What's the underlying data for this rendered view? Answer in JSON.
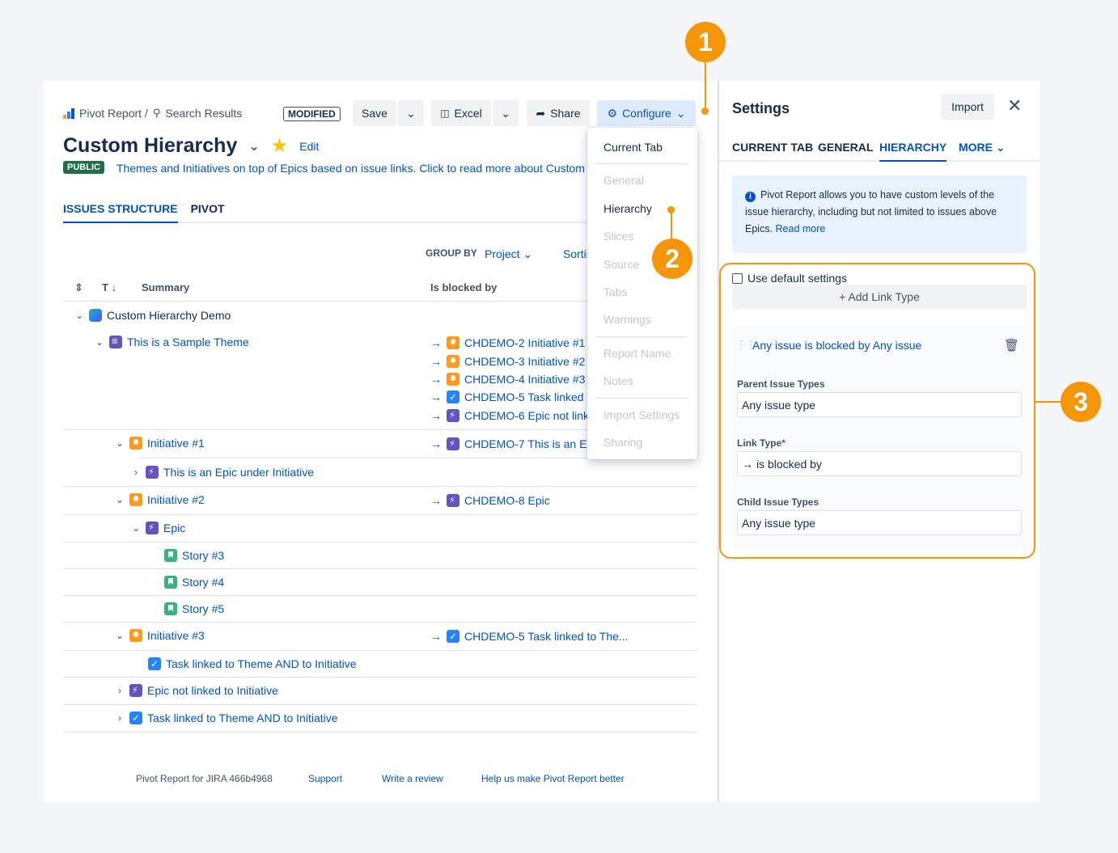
{
  "breadcrumb": {
    "root": "Pivot Report /",
    "current": "Search Results"
  },
  "status_badge": "MODIFIED",
  "toolbar": {
    "save": "Save",
    "excel": "Excel",
    "share": "Share",
    "configure": "Configure"
  },
  "report": {
    "title": "Custom Hierarchy",
    "edit": "Edit",
    "visibility": "PUBLIC",
    "description": "Themes and Initiatives on top of Epics based on issue links. Click to read more about Custom Hierarchy"
  },
  "tabs": [
    "ISSUES STRUCTURE",
    "PIVOT"
  ],
  "group_by": {
    "label": "GROUP BY",
    "value": "Project",
    "sorting": "Sorting"
  },
  "columns": {
    "type": "T",
    "summary": "Summary",
    "blocked_by": "Is blocked by"
  },
  "rows": {
    "project": "Custom Hierarchy Demo",
    "theme": "This is a Sample Theme",
    "theme_links": [
      "CHDEMO-2 Initiative #1",
      "CHDEMO-3 Initiative #2",
      "CHDEMO-4 Initiative #3",
      "CHDEMO-5 Task linked to Theme",
      "CHDEMO-6 Epic not linked"
    ],
    "initiative1": "Initiative #1",
    "initiative1_link": "CHDEMO-7 This is an Epic",
    "epic_under": "This is an Epic under Initiative",
    "initiative2": "Initiative #2",
    "initiative2_link": "CHDEMO-8 Epic",
    "epic": "Epic",
    "story3": "Story #3",
    "story4": "Story #4",
    "story5": "Story #5",
    "initiative3": "Initiative #3",
    "initiative3_link": "CHDEMO-5 Task linked to The...",
    "task_under": "Task linked to Theme AND to Initiative",
    "epic_not_linked": "Epic not linked to Initiative",
    "task_theme": "Task linked to Theme AND to Initiative"
  },
  "configure_menu": {
    "current_tab": "Current Tab",
    "general": "General",
    "hierarchy": "Hierarchy",
    "slices": "Slices",
    "source": "Source",
    "tabs": "Tabs",
    "warnings": "Warnings",
    "report_name": "Report Name",
    "notes": "Notes",
    "import_settings": "Import Settings",
    "sharing": "Sharing"
  },
  "footer": {
    "version": "Pivot Report for JIRA 466b4968",
    "support": "Support",
    "review": "Write a review",
    "feedback": "Help us make Pivot Report better"
  },
  "settings": {
    "title": "Settings",
    "import": "Import",
    "tabs": [
      "CURRENT TAB",
      "GENERAL",
      "HIERARCHY",
      "MORE"
    ],
    "info_text": "Pivot Report allows you to have custom levels of the issue hierarchy, including but not limited to issues above Epics.",
    "read_more": "Read more",
    "use_default": "Use default settings",
    "add_link": "+ Add Link Type",
    "rule_title": "Any issue is blocked by Any issue",
    "parent_label": "Parent Issue Types",
    "parent_value": "Any issue type",
    "link_label": "Link Type",
    "link_value": "is blocked by",
    "child_label": "Child Issue Types",
    "child_value": "Any issue type"
  },
  "callouts": [
    "1",
    "2",
    "3"
  ],
  "colors": {
    "accent": "#0052cc",
    "callout": "#f79509",
    "public": "#216e4e"
  }
}
